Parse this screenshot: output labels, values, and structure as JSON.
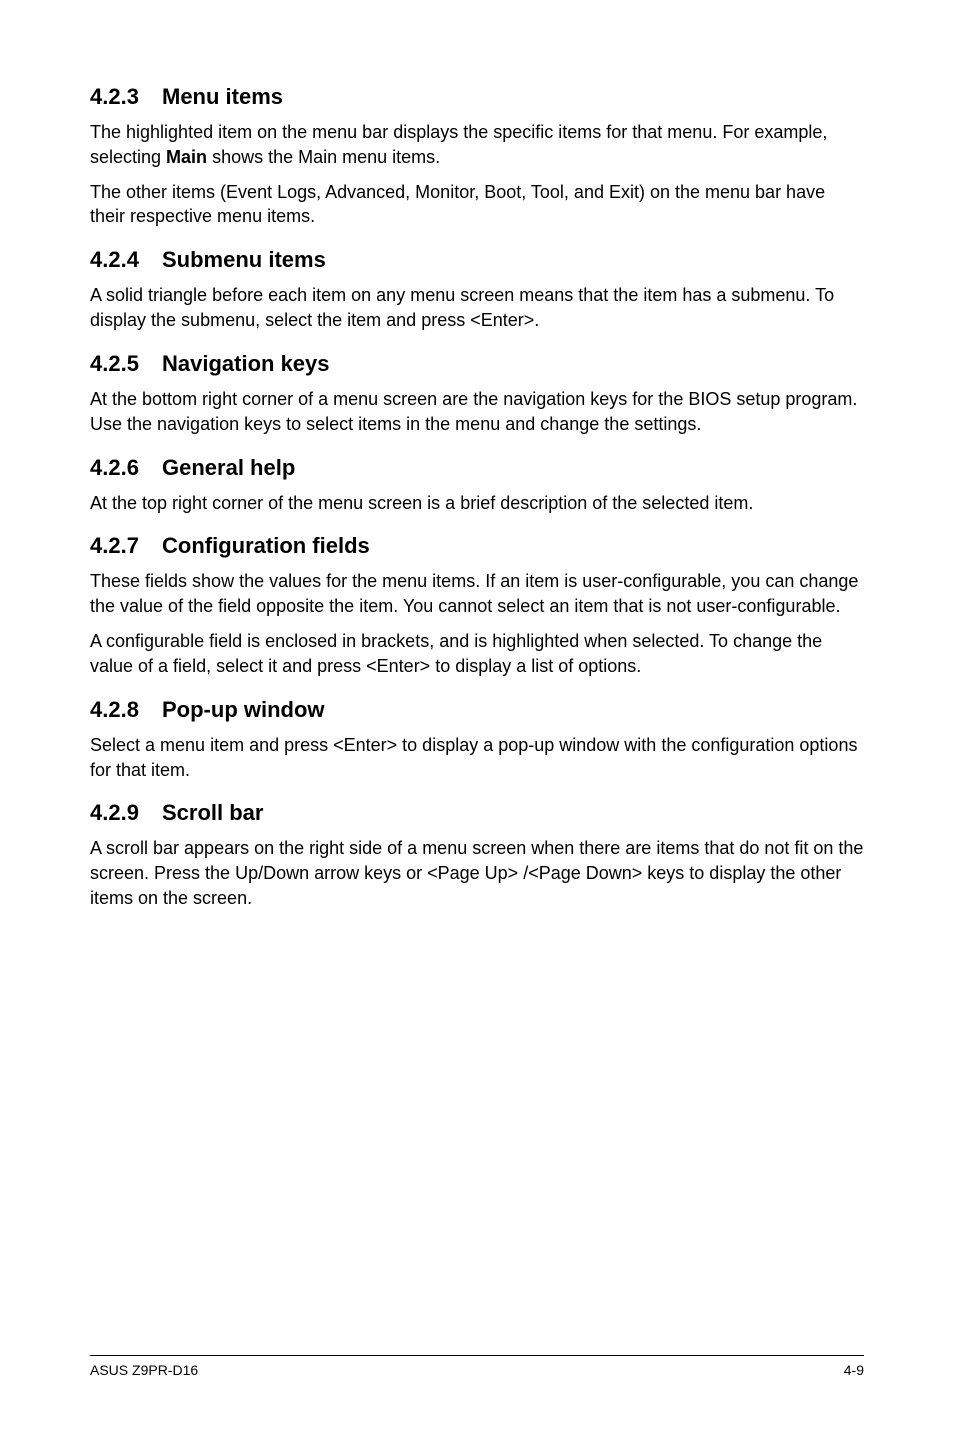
{
  "sections": {
    "s423": {
      "num": "4.2.3",
      "title": "Menu items",
      "p1a": "The highlighted item on the menu bar displays the specific items for that menu. For example, selecting ",
      "p1b": "Main",
      "p1c": " shows the Main menu items.",
      "p2": "The other items (Event Logs, Advanced, Monitor, Boot, Tool, and Exit) on the menu bar have their respective menu items."
    },
    "s424": {
      "num": "4.2.4",
      "title": "Submenu items",
      "p1": "A solid triangle before each item on any menu screen means that the item has a submenu. To display the submenu, select the item and press <Enter>."
    },
    "s425": {
      "num": "4.2.5",
      "title": "Navigation keys",
      "p1": "At the bottom right corner of a menu screen are the navigation keys for the BIOS setup program. Use the navigation keys to select items in the menu and change the settings."
    },
    "s426": {
      "num": "4.2.6",
      "title": "General help",
      "p1": "At the top right corner of the menu screen is a brief description of the selected item."
    },
    "s427": {
      "num": "4.2.7",
      "title": "Configuration fields",
      "p1": "These fields show the values for the menu items. If an item is user-configurable, you can change the value of the field opposite the item. You cannot select an item that is not user-configurable.",
      "p2": "A configurable field is enclosed in brackets, and is highlighted when selected. To change the value of a field, select it and press <Enter> to display a list of options."
    },
    "s428": {
      "num": "4.2.8",
      "title": "Pop-up window",
      "p1": "Select a menu item and press <Enter> to display a pop-up window with the configuration options for that item."
    },
    "s429": {
      "num": "4.2.9",
      "title": "Scroll bar",
      "p1": "A scroll bar appears on the right side of a menu screen when there are items that do not fit on the screen. Press the Up/Down arrow keys or <Page Up> /<Page Down> keys to display the other items on the screen."
    }
  },
  "footer": {
    "left": "ASUS Z9PR-D16",
    "right": "4-9"
  }
}
